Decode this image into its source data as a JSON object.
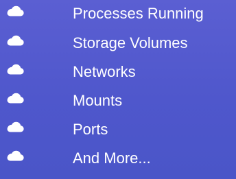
{
  "feature_list": {
    "items": [
      {
        "icon": "cloud-icon",
        "label": "Processes Running"
      },
      {
        "icon": "cloud-icon",
        "label": "Storage Volumes"
      },
      {
        "icon": "cloud-icon",
        "label": "Networks"
      },
      {
        "icon": "cloud-icon",
        "label": "Mounts"
      },
      {
        "icon": "cloud-icon",
        "label": "Ports"
      },
      {
        "icon": "cloud-icon",
        "label": "And More..."
      }
    ]
  },
  "colors": {
    "background_top": "#5b5fd2",
    "background_bottom": "#4a55c8",
    "text": "#ffffff",
    "icon": "#ffffff"
  }
}
